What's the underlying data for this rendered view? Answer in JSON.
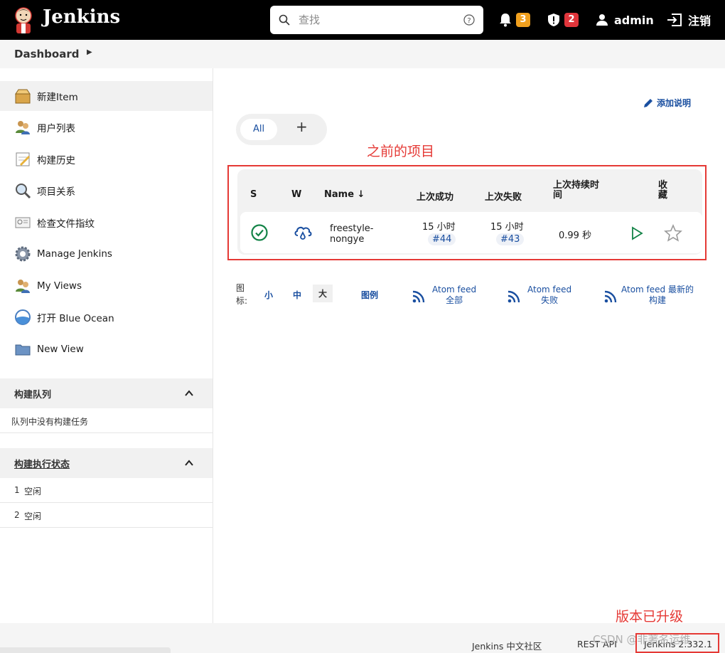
{
  "header": {
    "brand": "Jenkins",
    "search_placeholder": "查找",
    "notifications_count": "3",
    "security_count": "2",
    "user": "admin",
    "logout": "注销",
    "colors": {
      "bg": "#000000",
      "notif_badge": "#f0a01e",
      "security_badge": "#e0353b"
    }
  },
  "breadcrumb": {
    "item": "Dashboard"
  },
  "sidebar": {
    "items": [
      {
        "label": "新建Item",
        "icon": "new-item-icon"
      },
      {
        "label": "用户列表",
        "icon": "users-icon"
      },
      {
        "label": "构建历史",
        "icon": "notepad-icon"
      },
      {
        "label": "项目关系",
        "icon": "magnifier-icon"
      },
      {
        "label": "检查文件指纹",
        "icon": "fingerprint-icon"
      },
      {
        "label": "Manage Jenkins",
        "icon": "gear-icon"
      },
      {
        "label": "My Views",
        "icon": "users-icon"
      },
      {
        "label": "打开 Blue Ocean",
        "icon": "blue-ocean-icon"
      },
      {
        "label": "New View",
        "icon": "folder-icon"
      }
    ],
    "queue": {
      "title": "构建队列",
      "empty": "队列中没有构建任务"
    },
    "executors": {
      "title": "构建执行状态",
      "rows": [
        {
          "num": "1",
          "status": "空闲"
        },
        {
          "num": "2",
          "status": "空闲"
        }
      ]
    }
  },
  "main": {
    "add_description": "添加说明",
    "tabs": [
      {
        "label": "All"
      },
      {
        "label": "+"
      }
    ],
    "annotation_projects": "之前的项目",
    "table": {
      "headers": {
        "s": "S",
        "w": "W",
        "name": "Name ↓",
        "last_success": "上次成功",
        "last_failure": "上次失败",
        "last_duration_1": "上次持续时",
        "last_duration_2": "间",
        "fav_1": "收",
        "fav_2": "藏"
      },
      "rows": [
        {
          "name_1": "freestyle-",
          "name_2": "nongye",
          "success_time": "15 小时",
          "success_build": "#44",
          "failure_time": "15 小时",
          "failure_build": "#43",
          "duration": "0.99 秒",
          "status_icon": "success-check-icon",
          "weather_icon": "rain-cloud-icon"
        }
      ]
    },
    "legend": {
      "label_1": "图",
      "label_2": "标:",
      "sizes": [
        "小",
        "中",
        "大"
      ],
      "legend_link": "图例",
      "feed_all_1": "Atom feed",
      "feed_all_2": "全部",
      "feed_fail_1": "Atom feed",
      "feed_fail_2": "失败",
      "feed_latest_1": "Atom feed 最新的",
      "feed_latest_2": "构建"
    }
  },
  "footer": {
    "community": "Jenkins 中文社区",
    "rest_api": "REST API",
    "version": "Jenkins 2.332.1",
    "annotation_version": "版本已升级",
    "watermark": "CSDN @非著名运维"
  }
}
